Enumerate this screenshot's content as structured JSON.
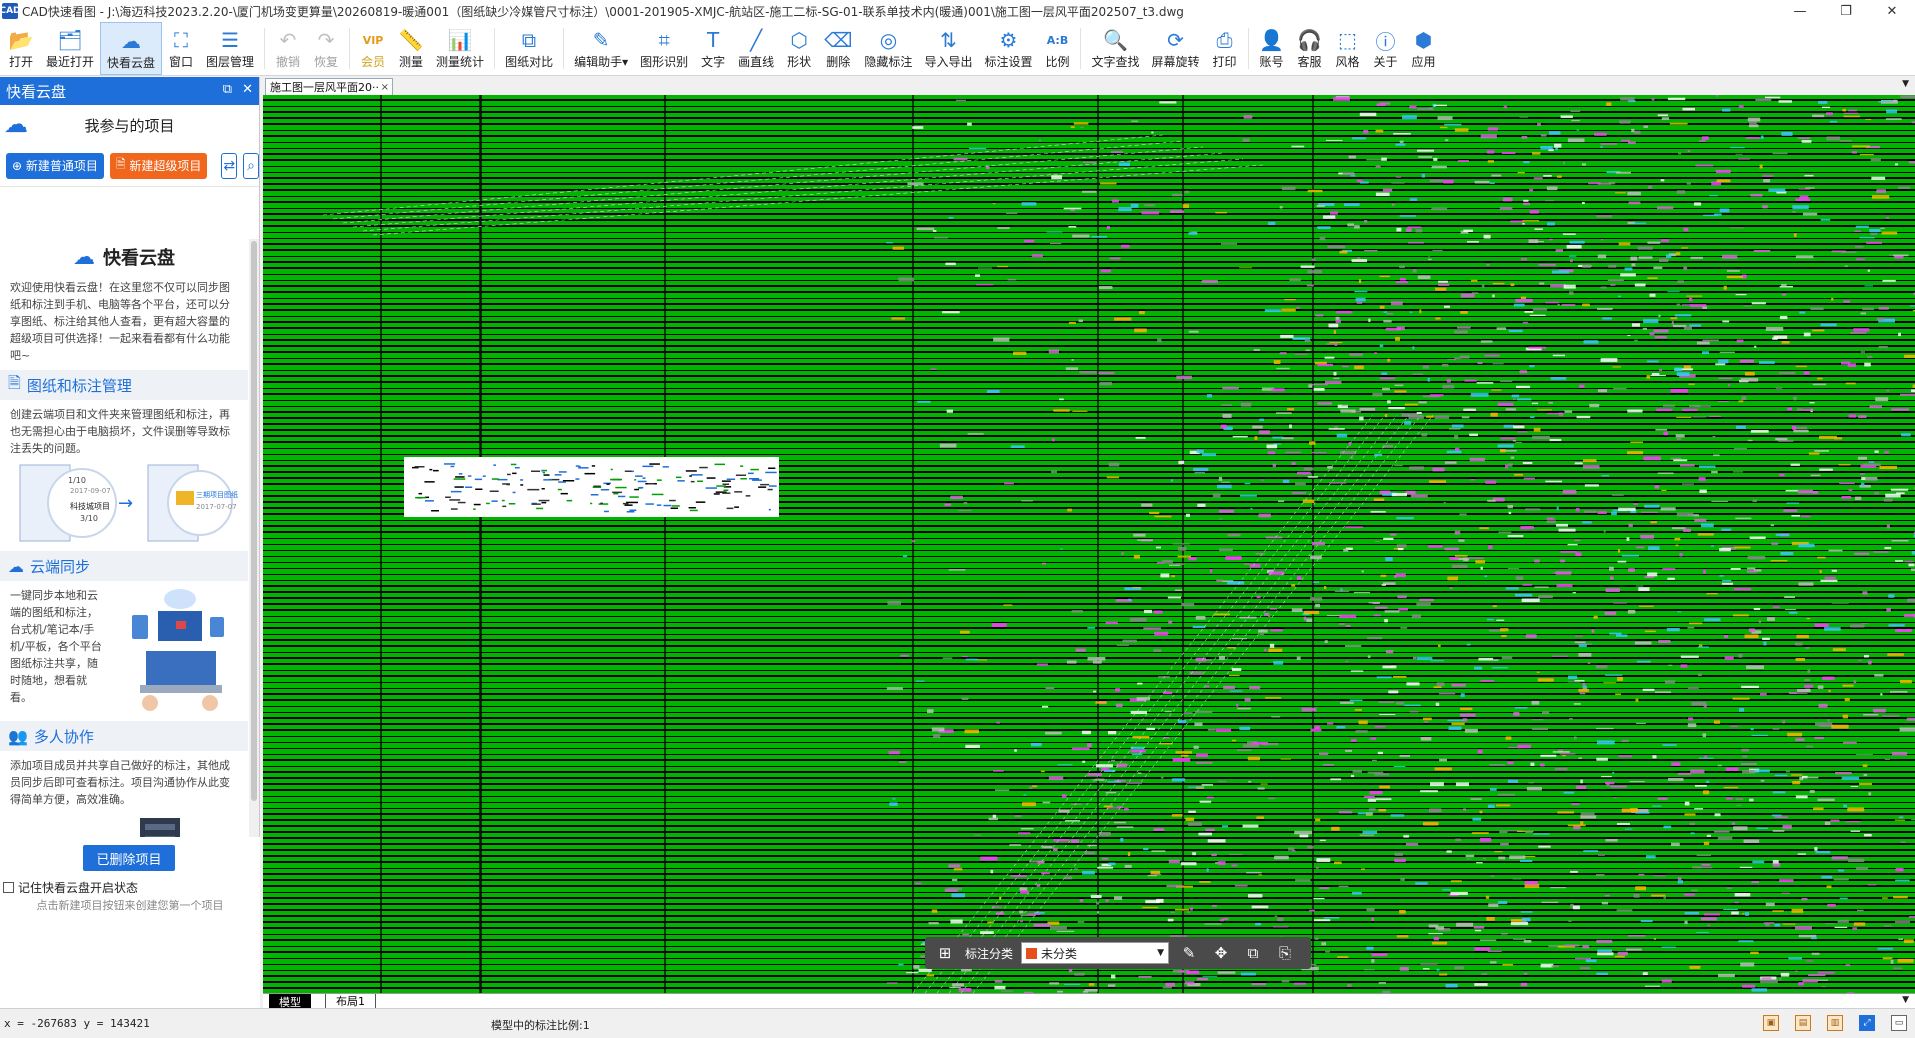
{
  "window": {
    "title": "CAD快速看图 - J:\\海迈科技2023.2.20-\\厦门机场变更算量\\20260819-暖通001（图纸缺少冷媒管尺寸标注）\\0001-201905-XMJC-航站区-施工二标-SG-01-联系单技术内(暖通)001\\施工图一层风平面202507_t3.dwg",
    "app_icon_text": "CAD",
    "minimize": "—",
    "restore": "❐",
    "close": "✕"
  },
  "toolbar": {
    "items": [
      {
        "label": "打开",
        "icon": "folder-open-icon",
        "glyph": "📂"
      },
      {
        "label": "最近打开",
        "icon": "recent-icon",
        "glyph": "🗂"
      },
      {
        "label": "快看云盘",
        "icon": "cloud-icon",
        "glyph": "☁",
        "active": true
      },
      {
        "label": "窗口",
        "icon": "window-icon",
        "glyph": "⛶"
      },
      {
        "label": "图层管理",
        "icon": "layers-icon",
        "glyph": "☰"
      },
      {
        "label": "撤销",
        "icon": "undo-icon",
        "glyph": "↶",
        "disabled": true
      },
      {
        "label": "恢复",
        "icon": "redo-icon",
        "glyph": "↷",
        "disabled": true
      },
      {
        "label": "会员",
        "icon": "vip-icon",
        "glyph": "VIP",
        "vip": true
      },
      {
        "label": "测量",
        "icon": "measure-icon",
        "glyph": "📏"
      },
      {
        "label": "测量统计",
        "icon": "measure-stats-icon",
        "glyph": "📊"
      },
      {
        "label": "图纸对比",
        "icon": "compare-icon",
        "glyph": "⧉"
      },
      {
        "label": "编辑助手▾",
        "icon": "edit-assistant-icon",
        "glyph": "✎"
      },
      {
        "label": "图形识别",
        "icon": "shape-recognize-icon",
        "glyph": "⌗"
      },
      {
        "label": "文字",
        "icon": "text-icon",
        "glyph": "T"
      },
      {
        "label": "画直线",
        "icon": "line-icon",
        "glyph": "╱"
      },
      {
        "label": "形状",
        "icon": "shape-icon",
        "glyph": "⬡"
      },
      {
        "label": "删除",
        "icon": "eraser-icon",
        "glyph": "⌫"
      },
      {
        "label": "隐藏标注",
        "icon": "hide-annotation-icon",
        "glyph": "◎"
      },
      {
        "label": "导入导出",
        "icon": "import-export-icon",
        "glyph": "⇅"
      },
      {
        "label": "标注设置",
        "icon": "annotation-settings-icon",
        "glyph": "⚙"
      },
      {
        "label": "比例",
        "icon": "scale-icon",
        "glyph": "A:B"
      },
      {
        "label": "文字查找",
        "icon": "text-search-icon",
        "glyph": "🔍"
      },
      {
        "label": "屏幕旋转",
        "icon": "rotate-screen-icon",
        "glyph": "⟳"
      },
      {
        "label": "打印",
        "icon": "print-icon",
        "glyph": "⎙"
      },
      {
        "label": "账号",
        "icon": "account-icon",
        "glyph": "👤"
      },
      {
        "label": "客服",
        "icon": "headset-icon",
        "glyph": "🎧"
      },
      {
        "label": "风格",
        "icon": "style-icon",
        "glyph": "⬚"
      },
      {
        "label": "关于",
        "icon": "info-icon",
        "glyph": "ⓘ"
      },
      {
        "label": "应用",
        "icon": "apps-icon",
        "glyph": "⬢"
      }
    ]
  },
  "left_panel": {
    "header": "快看云盘",
    "pin_glyph": "⧉",
    "close_glyph": "✕",
    "projects_title": "我参与的项目",
    "new_normal_project": "新建普通项目",
    "new_super_project": "新建超级项目",
    "intro": {
      "title": "快看云盘",
      "text": "欢迎使用快看云盘！在这里您不仅可以同步图纸和标注到手机、电脑等各个平台，还可以分享图纸、标注给其他人查看，更有超大容量的超级项目可供选择！一起来看看都有什么功能吧~",
      "sections": [
        {
          "title": "图纸和标注管理",
          "icon": "document-icon",
          "text": "创建云端项目和文件夹来管理图纸和标注，再也无需担心由于电脑损坏，文件误删等导致标注丢失的问题。"
        },
        {
          "title": "云端同步",
          "icon": "cloud-sync-icon",
          "text": "一键同步本地和云端的图纸和标注，台式机/笔记本/手机/平板，各个平台图纸标注共享，随时随地，想看就看。"
        },
        {
          "title": "多人协作",
          "icon": "team-icon",
          "text": "添加项目成员并共享自己做好的标注，其他成员同步后即可查看标注。项目沟通协作从此变得简单方便，高效准确。"
        }
      ],
      "illus_labels": {
        "a1": "1/10",
        "a2": "2017-09-07",
        "a3": "科技城项目",
        "a4": "3/10",
        "b1": "三期项目图纸",
        "b2": "2017-07-07"
      }
    },
    "deleted_projects": "已删除项目",
    "remember_label": "记住快看云盘开启状态",
    "hint": "点击新建项目按钮来创建您第一个项目"
  },
  "document_tab": {
    "label": "施工图一层风平面20··",
    "close": "×"
  },
  "annotation_bar": {
    "category_label": "标注分类",
    "category_value": "未分类",
    "category_color": "#e8501b"
  },
  "layout_tabs": [
    {
      "label": "模型",
      "active": true
    },
    {
      "label": "布局1",
      "active": false
    }
  ],
  "status_bar": {
    "coords": "x = -267683  y = 143421",
    "scale_text": "模型中的标注比例:1"
  },
  "colors": {
    "canvas_bg": "#000000",
    "drawing_green": "#00b400",
    "accent_blue": "#1e6fd9",
    "accent_orange": "#f0661d"
  }
}
